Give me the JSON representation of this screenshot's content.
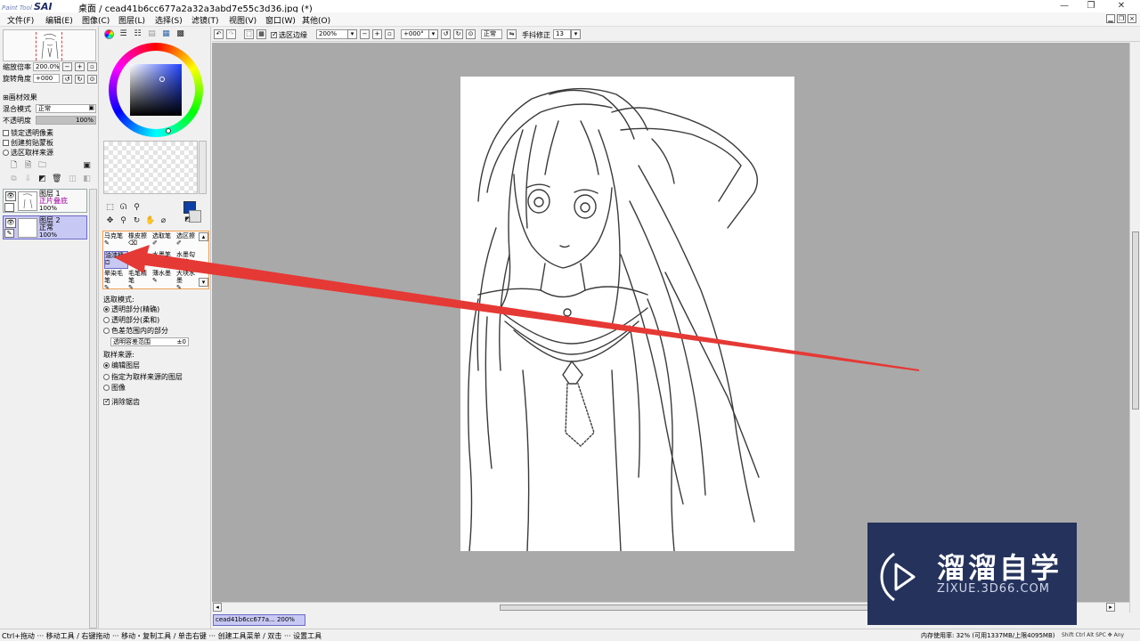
{
  "app": {
    "logo_small": "Paint Tool",
    "logo_big": "SAI",
    "title": "桌面 / cead41b6cc677a2a32a3abd7e55c3d36.jpg (*)"
  },
  "window_controls": {
    "minimize": "—",
    "maximize": "❐",
    "close": "✕"
  },
  "menu": [
    "文件(F)",
    "编辑(E)",
    "图像(C)",
    "图层(L)",
    "选择(S)",
    "滤镜(T)",
    "视图(V)",
    "窗口(W)",
    "其他(O)"
  ],
  "navigator": {
    "zoom_label": "缩放倍率",
    "zoom_value": "200.0%",
    "rotate_label": "旋转角度",
    "rotate_value": "+000"
  },
  "layer_props": {
    "texture_label": "画材效果",
    "blend_label": "混合模式",
    "blend_value": "正常",
    "opacity_label": "不透明度",
    "opacity_value": "100%",
    "opacity": 1.0,
    "checkboxes": [
      "锁定透明像素",
      "创建剪贴蒙板",
      "选区取样来源"
    ]
  },
  "layers": [
    {
      "name": "图层 1",
      "mode": "正片叠底",
      "opacity": "100%",
      "selected": false
    },
    {
      "name": "图层 2",
      "mode": "正常",
      "opacity": "100%",
      "selected": true
    }
  ],
  "colors": {
    "foreground": "#0d3fa6",
    "background": "#e0e0e0",
    "arrow": "#e53935",
    "selection": "#c8c8f4",
    "canvas_bg": "#a9a9a9"
  },
  "brushes": [
    {
      "label": "马克笔",
      "selected": false
    },
    {
      "label": "橡皮擦",
      "selected": false
    },
    {
      "label": "选取笔",
      "selected": false
    },
    {
      "label": "选区擦",
      "selected": false
    },
    {
      "label": "油漆桶",
      "selected": true
    },
    {
      "label": "二值笔",
      "selected": false
    },
    {
      "label": "水墨笔",
      "selected": false
    },
    {
      "label": "水墨勾线笔",
      "selected": false
    },
    {
      "label": "晕染毛笔",
      "selected": false
    },
    {
      "label": "毛笔精笔",
      "selected": false
    },
    {
      "label": "薄水墨",
      "selected": false
    },
    {
      "label": "大块水墨",
      "selected": false
    }
  ],
  "fill_options": {
    "mode_title": "选取模式:",
    "modes": [
      {
        "label": "透明部分(精确)",
        "checked": true
      },
      {
        "label": "透明部分(柔和)",
        "checked": false
      },
      {
        "label": "色差范围内的部分",
        "checked": false
      }
    ],
    "tolerance_label": "透明容差范围",
    "tolerance_value": "±0",
    "source_title": "取样来源:",
    "sources": [
      {
        "label": "编辑图层",
        "checked": true
      },
      {
        "label": "指定为取样来源的图层",
        "checked": false
      },
      {
        "label": "图像",
        "checked": false
      }
    ],
    "antialias_label": "消除锯齿",
    "antialias_checked": true
  },
  "canvas_toolbar": {
    "selection_edge_label": "选区边缘",
    "zoom": "200%",
    "rotation": "+000°",
    "mode": "正常",
    "stabilizer_label": "手抖修正",
    "stabilizer_value": "13"
  },
  "document_tab": "cead41b6cc677a... 200%",
  "status": {
    "left": "Ctrl+拖动 ··· 移动工具 / 右键拖动 ··· 移动・复制工具 / 单击右键 ··· 创建工具菜单 / 双击 ··· 设置工具",
    "memory": "内存使用率: 32% (可用1337MB/上限4095MB)",
    "keys": "Shift Ctrl Alt SPC ✥ Any"
  },
  "watermark": {
    "brand": "溜溜自学",
    "url": "ZIXUE.3D66.COM"
  }
}
